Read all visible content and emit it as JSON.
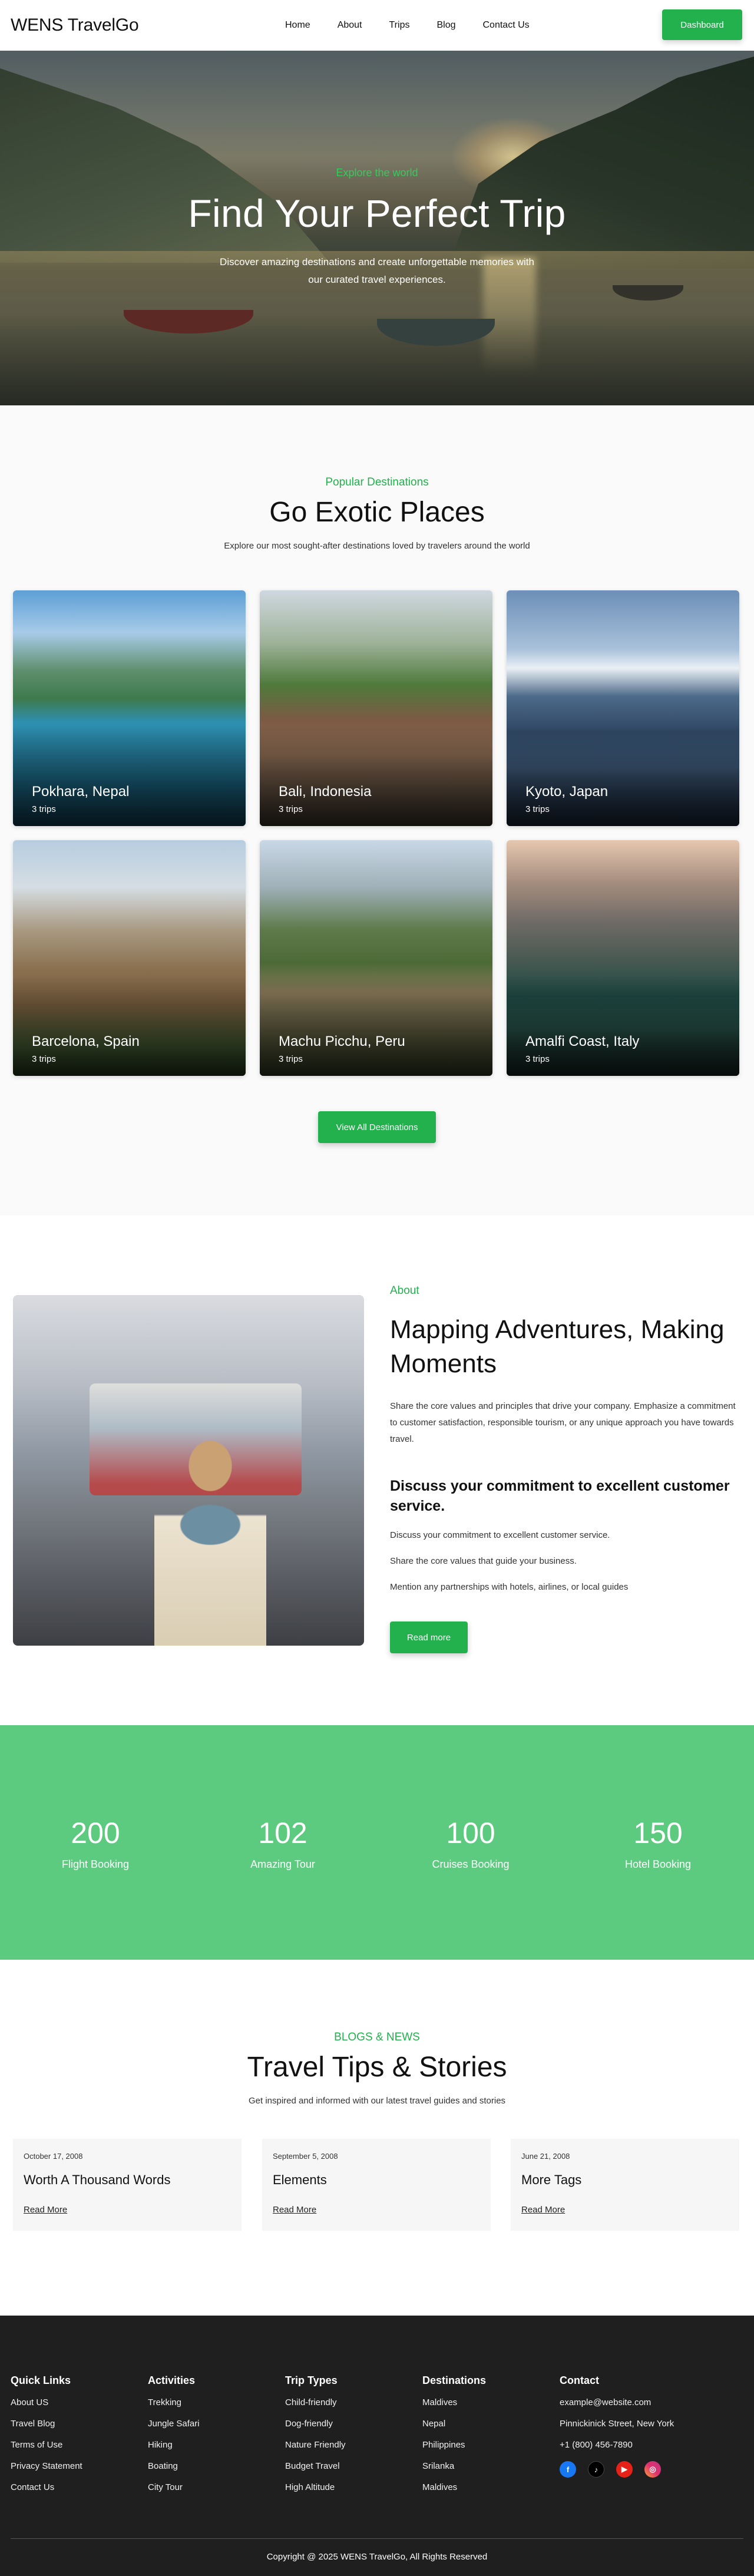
{
  "nav": {
    "logo": "WENS TravelGo",
    "links": [
      "Home",
      "About",
      "Trips",
      "Blog",
      "Contact Us"
    ],
    "dashboard": "Dashboard"
  },
  "hero": {
    "kicker": "Explore the world",
    "title": "Find Your Perfect Trip",
    "subtitle": "Discover amazing destinations and create unforgettable memories with our curated travel experiences."
  },
  "destinations": {
    "kicker": "Popular Destinations",
    "title": "Go Exotic Places",
    "lead": "Explore our most sought-after destinations loved by travelers around the world",
    "cards": [
      {
        "name": "Pokhara, Nepal",
        "trips": "3 trips"
      },
      {
        "name": "Bali, Indonesia",
        "trips": "3 trips"
      },
      {
        "name": "Kyoto, Japan",
        "trips": "3 trips"
      },
      {
        "name": "Barcelona, Spain",
        "trips": "3 trips"
      },
      {
        "name": "Machu Picchu, Peru",
        "trips": "3 trips"
      },
      {
        "name": "Amalfi Coast, Italy",
        "trips": "3 trips"
      }
    ],
    "button": "View All Destinations"
  },
  "about": {
    "kicker": "About",
    "title": "Mapping Adventures, Making Moments",
    "paragraph": "Share the core values and principles that drive your company. Emphasize a commitment to customer satisfaction, responsible tourism, or any unique approach you have towards travel.",
    "subtitle": "Discuss your commitment to excellent customer service.",
    "points": [
      "Discuss your commitment to excellent customer service.",
      "Share the core values that guide your business.",
      "Mention any partnerships with hotels, airlines, or local guides"
    ],
    "button": "Read more"
  },
  "stats": [
    {
      "value": "200",
      "label": "Flight Booking"
    },
    {
      "value": "102",
      "label": "Amazing Tour"
    },
    {
      "value": "100",
      "label": "Cruises Booking"
    },
    {
      "value": "150",
      "label": "Hotel Booking"
    }
  ],
  "blog": {
    "kicker": "BLOGS & NEWS",
    "title": "Travel Tips & Stories",
    "lead": "Get inspired and informed with our latest travel guides and stories",
    "posts": [
      {
        "date": "October 17, 2008",
        "title": "Worth A Thousand Words",
        "more": "Read More"
      },
      {
        "date": "September 5, 2008",
        "title": "Elements",
        "more": "Read More"
      },
      {
        "date": "June 21, 2008",
        "title": "More Tags",
        "more": "Read More"
      }
    ]
  },
  "footer": {
    "quick": {
      "title": "Quick Links",
      "items": [
        "About US",
        "Travel Blog",
        "Terms of Use",
        "Privacy Statement",
        "Contact Us"
      ]
    },
    "activities": {
      "title": "Activities",
      "items": [
        "Trekking",
        "Jungle Safari",
        "Hiking",
        "Boating",
        "City Tour"
      ]
    },
    "types": {
      "title": "Trip Types",
      "items": [
        "Child-friendly",
        "Dog-friendly",
        "Nature Friendly",
        "Budget Travel",
        "High Altitude"
      ]
    },
    "dests": {
      "title": "Destinations",
      "items": [
        "Maldives",
        "Nepal",
        "Philippines",
        "Srilanka",
        "Maldives"
      ]
    },
    "contact": {
      "title": "Contact",
      "email": "example@website.com",
      "address": "Pinnickinick Street, New York",
      "phone": "+1 (800) 456-7890"
    },
    "social_icons": [
      "facebook-icon",
      "tiktok-icon",
      "youtube-icon",
      "instagram-icon"
    ],
    "copyright": "Copyright @ 2025 WENS TravelGo, All Rights Reserved"
  },
  "colors": {
    "accent": "#22b14c",
    "stats_bg": "#5ccb80",
    "footer_bg": "#1f1f1f"
  }
}
